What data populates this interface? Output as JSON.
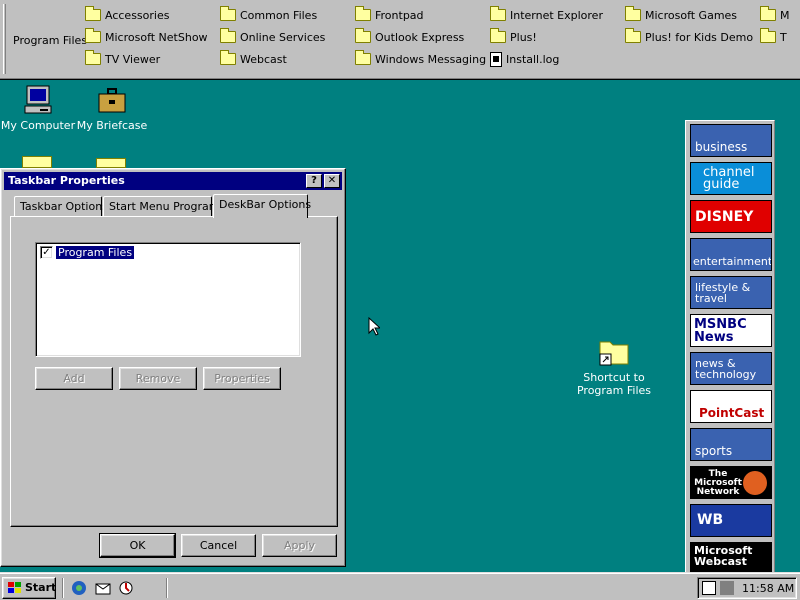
{
  "deskbar": {
    "title": "Program Files",
    "items": [
      {
        "label": "Accessories",
        "type": "folder"
      },
      {
        "label": "Common Files",
        "type": "folder"
      },
      {
        "label": "Frontpad",
        "type": "folder"
      },
      {
        "label": "Internet Explorer",
        "type": "folder"
      },
      {
        "label": "Microsoft Games",
        "type": "folder"
      },
      {
        "label": "M",
        "type": "folder"
      },
      {
        "label": "Microsoft NetShow",
        "type": "folder"
      },
      {
        "label": "Online Services",
        "type": "folder"
      },
      {
        "label": "Outlook Express",
        "type": "folder"
      },
      {
        "label": "Plus!",
        "type": "folder"
      },
      {
        "label": "Plus! for Kids Demo",
        "type": "folder"
      },
      {
        "label": "T",
        "type": "folder"
      },
      {
        "label": "TV Viewer",
        "type": "folder"
      },
      {
        "label": "Webcast",
        "type": "folder"
      },
      {
        "label": "Windows Messaging",
        "type": "folder"
      },
      {
        "label": "Install.log",
        "type": "file"
      }
    ]
  },
  "desktop": {
    "icons": [
      {
        "label": "My Computer",
        "icon": "computer-icon"
      },
      {
        "label": "My Briefcase",
        "icon": "briefcase-icon"
      }
    ],
    "shortcut": {
      "line1": "Shortcut to",
      "line2": "Program Files"
    }
  },
  "channels": [
    {
      "label": "business",
      "bg": "#3a62b0"
    },
    {
      "label": "channel guide",
      "bg": "#0a8ed8"
    },
    {
      "label": "DISNEY",
      "bg": "#e00000"
    },
    {
      "label": "entertainment",
      "bg": "#3a62b0"
    },
    {
      "label": "lifestyle & travel",
      "bg": "#3a62b0"
    },
    {
      "label": "MSNBC News",
      "bg": "#ffffff"
    },
    {
      "label": "news & technology",
      "bg": "#3a62b0"
    },
    {
      "label": "PointCast",
      "bg": "#ffffff"
    },
    {
      "label": "sports",
      "bg": "#3a62b0"
    },
    {
      "label": "The Microsoft Network",
      "bg": "#000000"
    },
    {
      "label": "WB",
      "bg": "#1a3aa0"
    },
    {
      "label": "Microsoft Webcast",
      "bg": "#000000"
    }
  ],
  "dialog": {
    "title": "Taskbar Properties",
    "help_label": "?",
    "close_label": "✕",
    "tabs": [
      {
        "label": "Taskbar Options"
      },
      {
        "label": "Start Menu Programs"
      },
      {
        "label": "DeskBar Options"
      }
    ],
    "list_item": "Program Files",
    "list_item_checked": "✓",
    "buttons": {
      "add": "Add",
      "remove": "Remove",
      "properties": "Properties",
      "ok": "OK",
      "cancel": "Cancel",
      "apply": "Apply"
    }
  },
  "taskbar": {
    "start_label": "Start",
    "clock": "11:58 AM"
  }
}
